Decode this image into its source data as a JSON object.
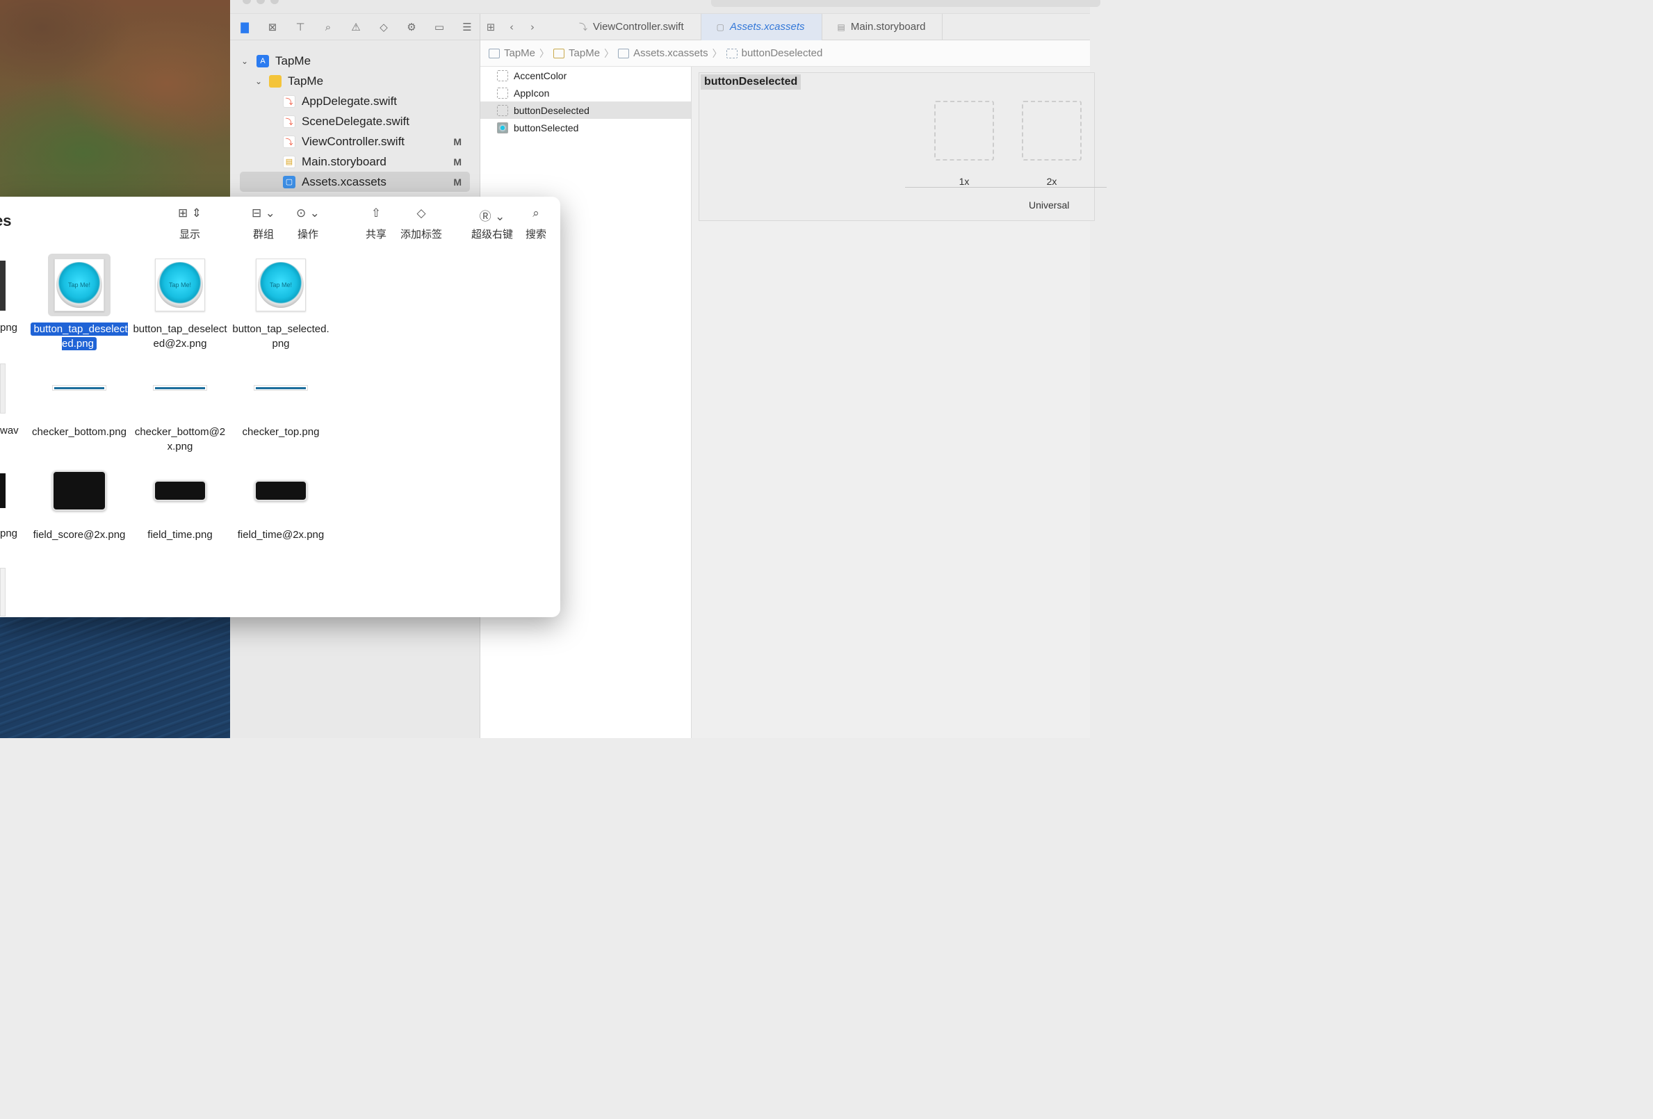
{
  "navigator": {
    "toolbar_icons": [
      "folder-icon",
      "source-control-icon",
      "symbol-icon",
      "search-icon",
      "warning-icon",
      "test-icon",
      "debug-icon",
      "breakpoint-icon",
      "report-icon"
    ],
    "tree": [
      {
        "label": "TapMe",
        "kind": "project",
        "badge": ""
      },
      {
        "label": "TapMe",
        "kind": "folder",
        "badge": ""
      },
      {
        "label": "AppDelegate.swift",
        "kind": "swift",
        "badge": ""
      },
      {
        "label": "SceneDelegate.swift",
        "kind": "swift",
        "badge": ""
      },
      {
        "label": "ViewController.swift",
        "kind": "swift",
        "badge": "M"
      },
      {
        "label": "Main.storyboard",
        "kind": "storyboard",
        "badge": "M"
      },
      {
        "label": "Assets.xcassets",
        "kind": "assets",
        "badge": "M"
      }
    ]
  },
  "editor": {
    "tabs": [
      {
        "label": "ViewController.swift"
      },
      {
        "label": "Assets.xcassets"
      },
      {
        "label": "Main.storyboard"
      }
    ],
    "breadcrumb": [
      "TapMe",
      "TapMe",
      "Assets.xcassets",
      "buttonDeselected"
    ],
    "assets": [
      "AccentColor",
      "AppIcon",
      "buttonDeselected",
      "buttonSelected"
    ],
    "detail": {
      "title": "buttonDeselected",
      "slot_1x": "1x",
      "slot_2x": "2x",
      "universal": "Universal"
    }
  },
  "finder": {
    "title_fragment": "es",
    "toolbar": [
      {
        "label": "显示",
        "icon": "view-grid-icon"
      },
      {
        "label": "群组",
        "icon": "group-icon"
      },
      {
        "label": "操作",
        "icon": "action-icon"
      },
      {
        "label": "共享",
        "icon": "share-icon"
      },
      {
        "label": "添加标签",
        "icon": "tag-icon"
      },
      {
        "label": "超级右键",
        "icon": "super-right-click-icon"
      },
      {
        "label": "搜索",
        "icon": "search-icon"
      }
    ],
    "partial_names": [
      "png",
      "wav",
      "png"
    ],
    "button_text": "Tap Me!",
    "files": [
      {
        "name": "button_tap_deselected.png"
      },
      {
        "name": "button_tap_deselected@2x.png"
      },
      {
        "name": "button_tap_selected.png"
      },
      {
        "name": "checker_bottom.png"
      },
      {
        "name": "checker_bottom@2x.png"
      },
      {
        "name": "checker_top.png"
      },
      {
        "name": "field_score@2x.png"
      },
      {
        "name": "field_time.png"
      },
      {
        "name": "field_time@2x.png"
      }
    ]
  }
}
